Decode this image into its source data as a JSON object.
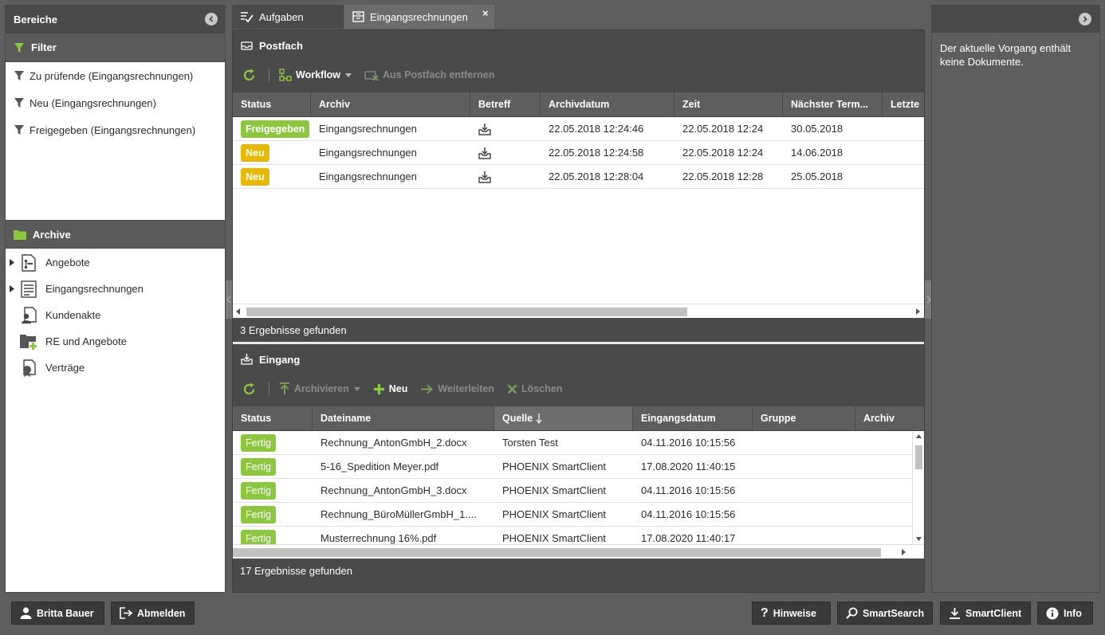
{
  "left": {
    "areas_title": "Bereiche",
    "filter_title": "Filter",
    "filters": [
      {
        "label": "Zu prüfende (Eingangsrechnungen)"
      },
      {
        "label": "Neu (Eingangsrechnungen)"
      },
      {
        "label": "Freigegeben (Eingangsrechnungen)"
      }
    ],
    "archive_title": "Archive",
    "archives": [
      {
        "label": "Angebote",
        "icon": "document-tree-icon",
        "expandable": true
      },
      {
        "label": "Eingangsrechnungen",
        "icon": "invoice-list-icon",
        "expandable": true
      },
      {
        "label": "Kundenakte",
        "icon": "customer-file-icon",
        "expandable": false
      },
      {
        "label": "RE und Angebote",
        "icon": "folder-add-icon",
        "expandable": false
      },
      {
        "label": "Verträge",
        "icon": "contract-icon",
        "expandable": false
      }
    ]
  },
  "tabs": [
    {
      "label": "Aufgaben",
      "icon": "tasks-icon",
      "active": true
    },
    {
      "label": "Eingangsrechnungen",
      "icon": "archive-box-icon",
      "active": false,
      "close": "×"
    }
  ],
  "postfach": {
    "title": "Postfach",
    "toolbar": {
      "workflow": "Workflow",
      "remove": "Aus Postfach entfernen"
    },
    "columns": [
      "Status",
      "Archiv",
      "Betreff",
      "Archivdatum",
      "Zeit",
      "Nächster Term...",
      "Letzte"
    ],
    "rows": [
      {
        "status": "Freigegeben",
        "status_color": "#8dc63f",
        "archiv": "Eingangsrechnungen",
        "archivdatum": "22.05.2018 12:24:46",
        "zeit": "22.05.2018 12:24",
        "termin": "30.05.2018"
      },
      {
        "status": "Neu",
        "status_color": "#e6b800",
        "archiv": "Eingangsrechnungen",
        "archivdatum": "22.05.2018 12:24:58",
        "zeit": "22.05.2018 12:24",
        "termin": "14.06.2018"
      },
      {
        "status": "Neu",
        "status_color": "#e6b800",
        "archiv": "Eingangsrechnungen",
        "archivdatum": "22.05.2018 12:28:04",
        "zeit": "22.05.2018 12:28",
        "termin": "25.05.2018"
      }
    ],
    "footer": "3 Ergebnisse gefunden"
  },
  "eingang": {
    "title": "Eingang",
    "toolbar": {
      "archive": "Archivieren",
      "new": "Neu",
      "forward": "Weiterleiten",
      "delete": "Löschen"
    },
    "columns": [
      "Status",
      "Dateiname",
      "Quelle",
      "Eingangsdatum",
      "Gruppe",
      "Archiv"
    ],
    "sorted_column": "Quelle",
    "rows": [
      {
        "status": "Fertig",
        "datei": "Rechnung_AntonGmbH_2.docx",
        "quelle": "Torsten Test",
        "datum": "04.11.2016 10:15:56"
      },
      {
        "status": "Fertig",
        "datei": "5-16_Spedition Meyer.pdf",
        "quelle": "PHOENIX SmartClient",
        "datum": "17.08.2020 11:40:15"
      },
      {
        "status": "Fertig",
        "datei": "Rechnung_AntonGmbH_3.docx",
        "quelle": "PHOENIX SmartClient",
        "datum": "04.11.2016 10:15:56"
      },
      {
        "status": "Fertig",
        "datei": "Rechnung_BüroMüllerGmbH_1....",
        "quelle": "PHOENIX SmartClient",
        "datum": "04.11.2016 10:15:56"
      },
      {
        "status": "Fertig",
        "datei": "Musterrechnung 16%.pdf",
        "quelle": "PHOENIX SmartClient",
        "datum": "17.08.2020 11:40:17"
      }
    ],
    "status_color": "#8dc63f",
    "footer": "17 Ergebnisse gefunden"
  },
  "right": {
    "message": "Der aktuelle Vorgang enthält keine Dokumente."
  },
  "bottom": {
    "user": "Britta Bauer",
    "logout": "Abmelden",
    "hints": "Hinweise",
    "smartsearch": "SmartSearch",
    "smartclient": "SmartClient",
    "info": "Info"
  },
  "colors": {
    "accent_green": "#8dc63f",
    "status_yellow": "#e6b800",
    "chrome_dark": "#4a4a4a",
    "chrome_mid": "#5e5e5e"
  }
}
